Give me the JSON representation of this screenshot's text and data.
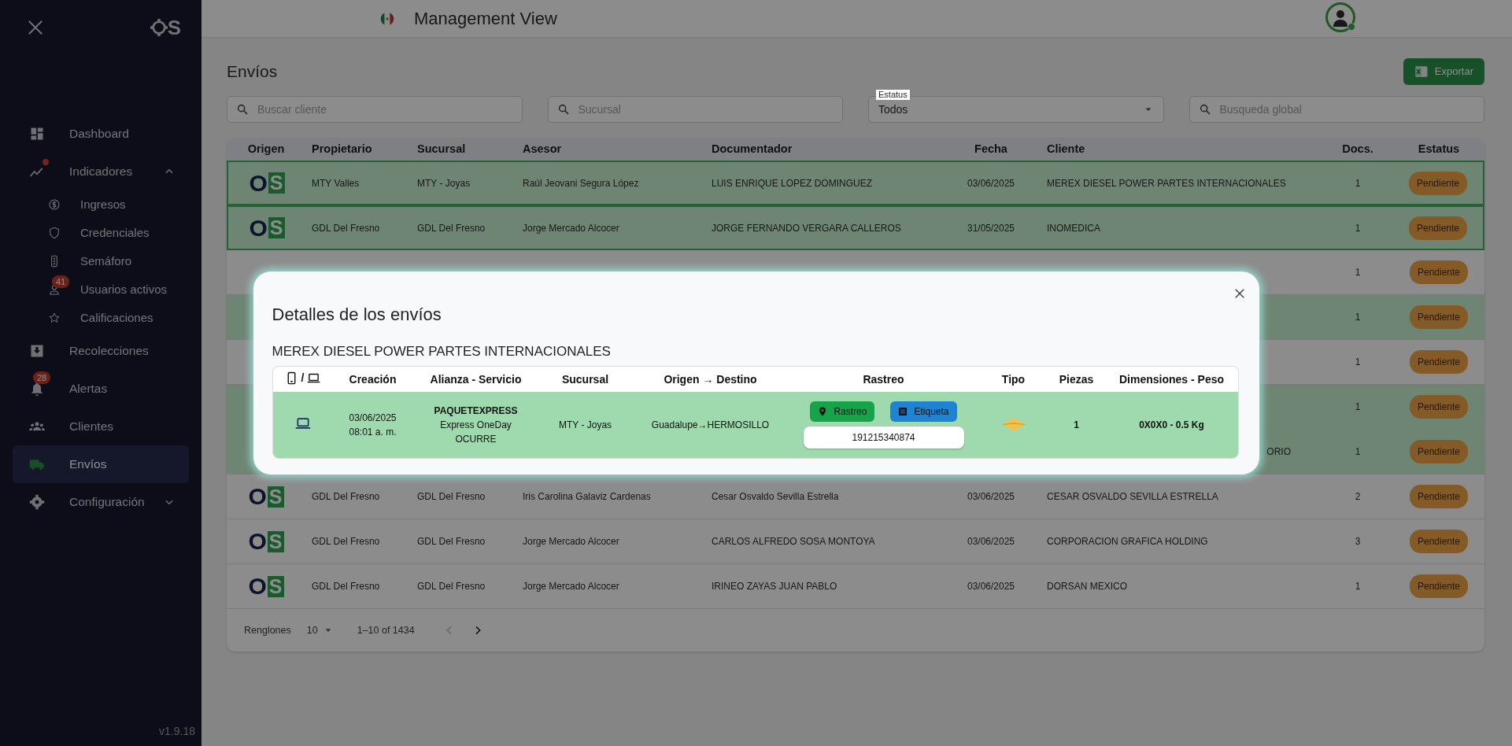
{
  "sidebar": {
    "logo": {
      "mark": "S"
    },
    "items": [
      {
        "label": "Dashboard",
        "selected": false
      },
      {
        "label": "Indicadores",
        "selected": false,
        "expanded": true,
        "alert_dot": true,
        "children": [
          {
            "label": "Ingresos"
          },
          {
            "label": "Credenciales"
          },
          {
            "label": "Semáforo"
          },
          {
            "label": "Usuarios activos",
            "badge": "41"
          },
          {
            "label": "Calificaciones"
          }
        ]
      },
      {
        "label": "Recolecciones",
        "selected": false
      },
      {
        "label": "Alertas",
        "selected": false,
        "badge": "28"
      },
      {
        "label": "Clientes",
        "selected": false
      },
      {
        "label": "Envíos",
        "selected": true
      },
      {
        "label": "Configuración",
        "selected": false,
        "expanded": false
      }
    ],
    "version": "v1.9.18"
  },
  "header": {
    "title": "Management View",
    "user_online": true
  },
  "page": {
    "title": "Envíos",
    "export_button": "Exportar"
  },
  "filters": [
    {
      "kind": "search",
      "placeholder": "Buscar cliente"
    },
    {
      "kind": "search",
      "placeholder": "Sucursal"
    },
    {
      "kind": "select",
      "label": "Estatus",
      "value": "Todos"
    },
    {
      "kind": "search",
      "placeholder": "Busqueda global"
    }
  ],
  "table": {
    "columns": [
      "Origen",
      "Propietario",
      "Sucursal",
      "Asesor",
      "Documentador",
      "Fecha",
      "Cliente",
      "Docs.",
      "Estatus"
    ],
    "rows": [
      {
        "origen": {
          "mark": "O",
          "tag": "S"
        },
        "selected": true,
        "highlighted": true,
        "propietario": "MTY Valles",
        "sucursal": "MTY - Joyas",
        "asesor": "Raúl Jeovani Segura López",
        "documentador": "LUIS ENRIQUE LOPEZ DOMINGUEZ",
        "fecha": "03/06/2025",
        "cliente": "MEREX DIESEL POWER PARTES INTERNACIONALES",
        "docs": "1",
        "estatus": "Pendiente"
      },
      {
        "origen": {
          "mark": "O",
          "tag": "S"
        },
        "selected": true,
        "highlighted": true,
        "propietario": "GDL Del Fresno",
        "sucursal": "GDL Del Fresno",
        "asesor": "Jorge Mercado Alcocer",
        "documentador": "JORGE FERNANDO VERGARA CALLEROS",
        "fecha": "31/05/2025",
        "cliente": "INOMEDICA",
        "docs": "1",
        "estatus": "Pendiente"
      },
      {
        "selected": false,
        "highlighted": false,
        "docs": "1",
        "estatus": "Pendiente"
      },
      {
        "selected": false,
        "highlighted": true,
        "docs": "1",
        "estatus": "Pendiente"
      },
      {
        "selected": false,
        "highlighted": false,
        "docs": "1",
        "estatus": "Pendiente"
      },
      {
        "selected": false,
        "highlighted": true,
        "docs": "1",
        "estatus": "Pendiente"
      },
      {
        "selected": false,
        "highlighted": true,
        "cliente": "ORIO",
        "docs": "1",
        "estatus": "Pendiente"
      },
      {
        "origen": {
          "mark": "O",
          "tag": "S"
        },
        "selected": false,
        "highlighted": false,
        "propietario": "GDL Del Fresno",
        "sucursal": "GDL Del Fresno",
        "asesor": "Iris Carolina Galaviz Cardenas",
        "documentador": "Cesar Osvaldo Sevilla Estrella",
        "fecha": "03/06/2025",
        "cliente": "CESAR OSVALDO SEVILLA ESTRELLA",
        "docs": "2",
        "estatus": "Pendiente"
      },
      {
        "origen": {
          "mark": "O",
          "tag": "S"
        },
        "selected": false,
        "highlighted": false,
        "propietario": "GDL Del Fresno",
        "sucursal": "GDL Del Fresno",
        "asesor": "Jorge Mercado Alcocer",
        "documentador": "CARLOS ALFREDO SOSA MONTOYA",
        "fecha": "03/06/2025",
        "cliente": "CORPORACION GRAFICA HOLDING",
        "docs": "3",
        "estatus": "Pendiente"
      },
      {
        "origen": {
          "mark": "O",
          "tag": "S"
        },
        "selected": false,
        "highlighted": false,
        "propietario": "GDL Del Fresno",
        "sucursal": "GDL Del Fresno",
        "asesor": "Jorge Mercado Alcocer",
        "documentador": "IRINEO ZAYAS JUAN PABLO",
        "fecha": "03/06/2025",
        "cliente": "DORSAN MEXICO",
        "docs": "1",
        "estatus": "Pendiente"
      }
    ]
  },
  "pagination": {
    "rows_label": "Renglones",
    "rows_per_page": "10",
    "range": "1–10 of 1434",
    "prev_disabled": true,
    "next_disabled": false
  },
  "modal": {
    "title": "Detalles de los envíos",
    "subtitle": "MEREX DIESEL POWER PARTES INTERNACIONALES",
    "device_separator": "/",
    "columns": [
      "Creación",
      "Alianza - Servicio",
      "Sucursal",
      "Origen → Destino",
      "Rastreo",
      "Tipo",
      "Piezas",
      "Dimensiones - Peso"
    ],
    "rows": [
      {
        "device": {
          "kind": "desktop"
        },
        "fecha": "03/06/2025",
        "hora": "08:01 a. m.",
        "alianza": "PAQUETEXPRESS",
        "servicio": [
          "Express OneDay",
          "OCURRE"
        ],
        "sucursal": "MTY - Joyas",
        "ruta": "Guadalupe→HERMOSILLO",
        "actions": [
          {
            "kind": "track",
            "label": "Rastreo"
          },
          {
            "kind": "label",
            "label": "Etiqueta"
          }
        ],
        "guia": "191215340874",
        "tipo": {
          "kind": "envelope"
        },
        "piezas": "1",
        "dimensiones": "0X0X0 - 0.5 Kg"
      }
    ]
  }
}
